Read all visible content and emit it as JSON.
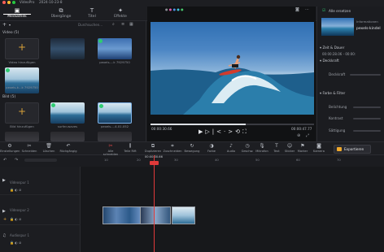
{
  "window": {
    "app_name": "VideoPro",
    "menu_label": "2024-10-23-8"
  },
  "top_tabs": [
    {
      "label": "Mediathek",
      "icon": "media-library-icon",
      "active": true
    },
    {
      "label": "Übergänge",
      "icon": "transitions-icon",
      "active": false
    },
    {
      "label": "Titel",
      "icon": "title-icon",
      "active": false
    },
    {
      "label": "Effekte",
      "icon": "effects-icon",
      "active": false
    }
  ],
  "media": {
    "search_placeholder": "Durchsuchen...",
    "video_section": "Video (5)",
    "image_section": "Bild (5)",
    "add_video_label": "Video hinzufügen",
    "add_image_label": "Bild hinzufügen",
    "video_captions": [
      "Video hinzufügen",
      "",
      "pexels-...k 7929750",
      "pexels-k...k 7929750"
    ],
    "image_captions": [
      "Bild hinzufügen",
      "surfer-waves",
      "pexels-...4.01.052",
      "",
      "",
      ""
    ]
  },
  "preview": {
    "time_current": "00:00:30.66",
    "time_total": "00:00:47.77",
    "progress": 0.58
  },
  "properties": {
    "replace_label": "Alle ersetzen",
    "info_label": "Informationen",
    "clip_name": "pexels-kindel",
    "time_section": "Zeit & Dauer",
    "time_value": "00:00:28.06 - 00:00:",
    "opacity_section": "Deckkraft",
    "opacity_label": "Deckkraft",
    "color_section": "Farbe & Filter",
    "brightness_label": "Belichtung",
    "contrast_label": "Kontrast",
    "saturation_label": "Sättigung"
  },
  "toolbar": {
    "tools": [
      "Einstellungen",
      "Schneiden",
      "Löschen",
      "Rückgängig",
      "Alle schneiden",
      "Teile Rift",
      "Duplizieren",
      "Zuschneiden",
      "Bewegung",
      "Farbe",
      "Audio",
      "Geschw.",
      "Mikrofon",
      "Text",
      "Sticker",
      "Marker",
      "Kamera"
    ],
    "export_label": "Exportieren"
  },
  "timeline": {
    "ruler_labels": [
      "10",
      "20",
      "30",
      "40",
      "50",
      "60",
      "70"
    ],
    "playhead_label": "00:00:30.66",
    "tracks": [
      {
        "name": "Videospur 1",
        "icon": "video-track-icon"
      },
      {
        "name": "Videospur 2",
        "icon": "video-track-icon"
      },
      {
        "name": "Audiospur 1",
        "icon": "audio-track-icon"
      }
    ]
  }
}
